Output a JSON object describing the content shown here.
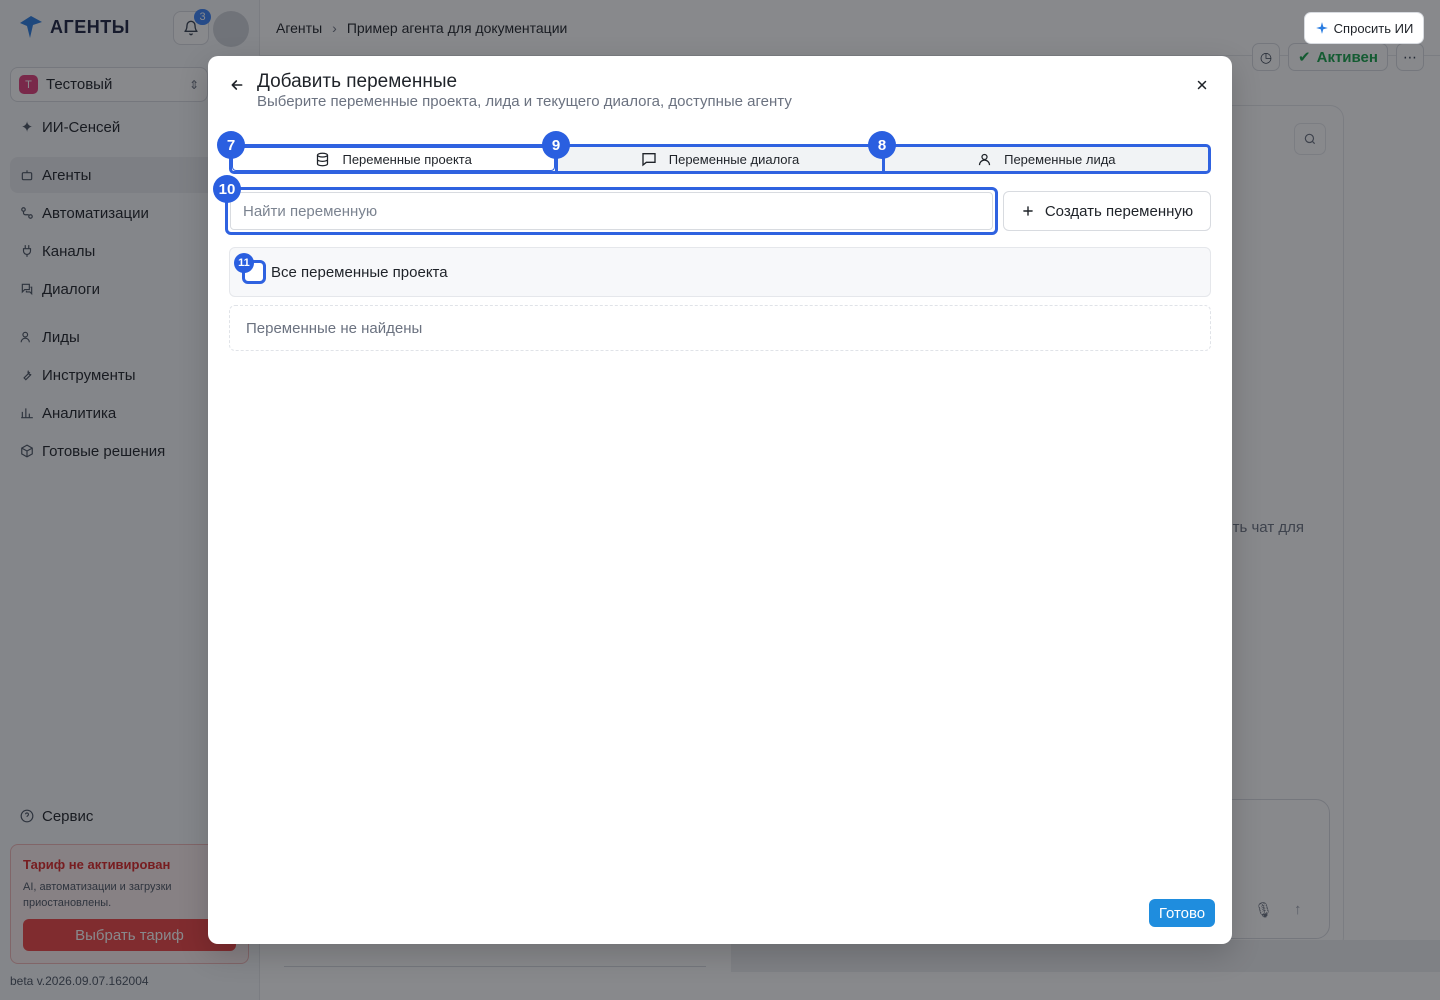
{
  "app": {
    "logo_text": "АГЕНТЫ",
    "notifications_count": "3",
    "project": {
      "badge": "Т",
      "name": "Тестовый"
    },
    "nav": [
      {
        "label": "ИИ-Сенсей",
        "icon": "sparkle-icon"
      },
      {
        "label": "Агенты",
        "icon": "bot-icon",
        "active": true
      },
      {
        "label": "Автоматизации",
        "icon": "workflow-icon"
      },
      {
        "label": "Каналы",
        "icon": "plug-icon"
      },
      {
        "label": "Диалоги",
        "icon": "messages-icon"
      },
      {
        "label": "Лиды",
        "icon": "users-icon"
      },
      {
        "label": "Инструменты",
        "icon": "wrench-icon"
      },
      {
        "label": "Аналитика",
        "icon": "chart-icon"
      },
      {
        "label": "Готовые решения",
        "icon": "box-icon"
      }
    ],
    "service_label": "Сервис",
    "tariff": {
      "title": "Тариф не активирован",
      "description": "AI, автоматизации и загрузки приостановлены.",
      "button": "Выбрать тариф"
    },
    "version": "beta v.2026.09.07.162004",
    "breadcrumbs": [
      "Агенты",
      "Пример агента для документации"
    ],
    "ask_ai": "Спросить ИИ",
    "agent_status": "Активен",
    "chat_hint_fragment": "ть чат для",
    "colors": {
      "accent": "#2f62e0",
      "primary_button": "#1f8dde",
      "danger": "#ef4444",
      "success": "#16a34a"
    }
  },
  "modal": {
    "title": "Добавить переменные",
    "subtitle": "Выберите переменные проекта, лида и текущего диалога, доступные агенту",
    "tabs": [
      {
        "label": "Переменные проекта",
        "icon": "database-icon",
        "marker": "7",
        "active": true
      },
      {
        "label": "Переменные диалога",
        "icon": "message-square-icon",
        "marker": "9",
        "active": false
      },
      {
        "label": "Переменные лида",
        "icon": "user-icon",
        "marker": "8",
        "active": false
      }
    ],
    "search": {
      "marker": "10",
      "placeholder": "Найти переменную",
      "value": ""
    },
    "create_button": "Создать переменную",
    "select_all": {
      "marker": "11",
      "label": "Все переменные проекта",
      "checked": false
    },
    "empty_state": "Переменные не найдены",
    "done_button": "Готово"
  }
}
